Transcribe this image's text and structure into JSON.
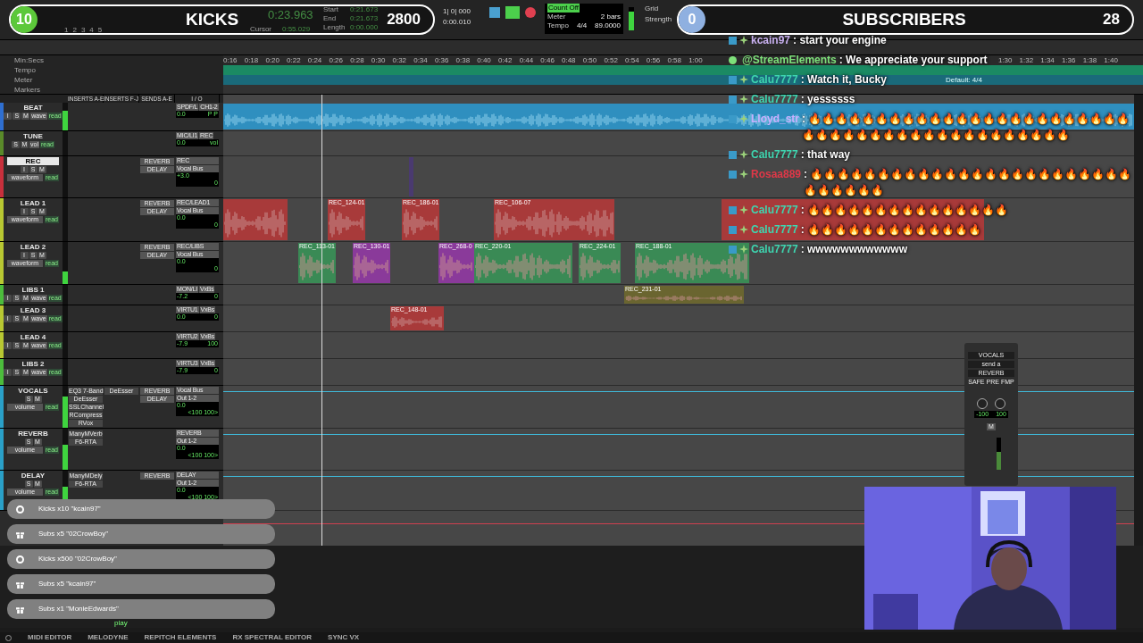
{
  "top_counters": [
    {
      "count": "10",
      "label": "KICKS",
      "total": "2800",
      "color": "#5cc83a"
    },
    {
      "count": "0",
      "label": "SUBSCRIBERS",
      "total": "28",
      "color": "#8fb0e0"
    }
  ],
  "toolbar": {
    "track_numbers": [
      "1",
      "2",
      "3",
      "4",
      "5"
    ],
    "main_counter": "0:23.963",
    "cursor_label": "Cursor",
    "cursor_value": "0:55.029",
    "selection": [
      {
        "label": "Start",
        "value": "0:21.673"
      },
      {
        "label": "End",
        "value": "0:21.673"
      },
      {
        "label": "Length",
        "value": "0:00.000"
      }
    ],
    "nudge": [
      "1| 0| 000",
      "0:00.010"
    ],
    "count_off": "Count Off",
    "meter_label": "Meter",
    "tempo_label": "Tempo",
    "bars": "2 bars",
    "meter": "4/4",
    "tempo": "89.0000",
    "grid_label": "Grid",
    "strength_label": "Strength",
    "level": 0.8
  },
  "rulers": {
    "labels": [
      "Min:Secs",
      "Tempo",
      "Meter",
      "Markers"
    ],
    "meter_default": "Default: 4/4",
    "ticks_left": [
      "0:16",
      "0:18",
      "0:20",
      "0:22",
      "0:24",
      "0:26",
      "0:28",
      "0:30",
      "0:32",
      "0:34",
      "0:36",
      "0:38",
      "0:40",
      "0:42",
      "0:44",
      "0:46",
      "0:48",
      "0:50",
      "0:52",
      "0:54",
      "0:56",
      "0:58",
      "1:00"
    ],
    "ticks_right": [
      "1:30",
      "1:32",
      "1:34",
      "1:36",
      "1:38",
      "1:40"
    ]
  },
  "columns": [
    "INSERTS A-E",
    "INSERTS F-J",
    "SENDS A-E",
    "I / O"
  ],
  "tracks": [
    {
      "name": "BEAT",
      "color": "#2f6fd0",
      "selected": false,
      "buttons": [
        "I",
        "S",
        "M"
      ],
      "view": "wave",
      "automation": "read",
      "io_in": "SPDF/L",
      "io_out": "CH1-2",
      "vol": "0.0",
      "pan": "P P",
      "level": 0.7,
      "clips": [
        {
          "color": "#2f8fbf"
        }
      ]
    },
    {
      "name": "TUNE",
      "color": "#5a8a2a",
      "selected": false,
      "buttons": [
        "S",
        "M"
      ],
      "view": "vol",
      "automation": "read",
      "io_in": "MIC/LI1",
      "io_out": "REC",
      "vol": "0.0",
      "pan": "vol"
    },
    {
      "name": "REC",
      "color": "#c8303c",
      "selected": true,
      "buttons": [
        "I",
        "S",
        "M"
      ],
      "view": "waveform",
      "automation": "read",
      "sends": [
        "REVERB",
        "DELAY"
      ],
      "io_in": "REC",
      "io_out": "Vocal Bus",
      "vol": "+3.0",
      "pan": "0",
      "clips": [
        {
          "color": "#4a3a70"
        }
      ]
    },
    {
      "name": "LEAD 1",
      "color": "#b8c832",
      "selected": false,
      "buttons": [
        "I",
        "S",
        "M"
      ],
      "view": "waveform",
      "automation": "read",
      "sends": [
        "REVERB",
        "DELAY"
      ],
      "io_in": "REC/LEAD1",
      "io_out": "Vocal Bus",
      "vol": "0.0",
      "pan": "0",
      "clips": [
        {
          "color": "#a83a3a"
        },
        {
          "label": "REC_124-01",
          "color": "#a83a3a"
        },
        {
          "label": "REC_186-01",
          "color": "#a83a3a"
        },
        {
          "label": "REC_106-07",
          "color": "#a83a3a"
        },
        {
          "color": "#a83a3a"
        }
      ]
    },
    {
      "name": "LEAD 2",
      "color": "#b8c832",
      "selected": false,
      "buttons": [
        "I",
        "S",
        "M"
      ],
      "view": "waveform",
      "automation": "read",
      "sends": [
        "REVERB",
        "DELAY"
      ],
      "io_in": "REC/LIBS",
      "io_out": "Vocal Bus",
      "vol": "0.0",
      "pan": "0",
      "level": 0.3,
      "clips": [
        {
          "label": "REC_113-01",
          "color": "#3a8a55"
        },
        {
          "label": "REC_130-01",
          "color": "#8a3a9a"
        },
        {
          "label": "REC_268-0",
          "color": "#8a3a9a"
        },
        {
          "label": "REC_220-01",
          "color": "#3a8a55"
        },
        {
          "label": "REC_224-01",
          "color": "#3a8a55"
        },
        {
          "label": "REC_188-01",
          "color": "#3a8a55"
        }
      ]
    },
    {
      "name": "LIBS 1",
      "color": "#4cbc3c",
      "selected": false,
      "buttons": [
        "I",
        "S",
        "M"
      ],
      "view": "wave",
      "automation": "read",
      "io_in": "MON/LI",
      "io_out": "VxBs",
      "vol": "-7.2",
      "pan": "0",
      "clips": [
        {
          "label": "REC_231-01",
          "color": "#6a6530"
        }
      ]
    },
    {
      "name": "LEAD 3",
      "color": "#b8c832",
      "selected": false,
      "buttons": [
        "I",
        "S",
        "M"
      ],
      "view": "wave",
      "automation": "read",
      "io_in": "VIRTU1",
      "io_out": "VxBs",
      "vol": "0.0",
      "pan": "0",
      "clips": [
        {
          "label": "REC_148-01",
          "color": "#a83a3a"
        }
      ]
    },
    {
      "name": "LEAD 4",
      "color": "#b8c832",
      "selected": false,
      "buttons": [
        "I",
        "S",
        "M"
      ],
      "view": "wave",
      "automation": "read",
      "io_in": "VIRTU2",
      "io_out": "VxBs",
      "vol": "-7.9",
      "pan": "100"
    },
    {
      "name": "LIBS 2",
      "color": "#4cbc3c",
      "selected": false,
      "buttons": [
        "I",
        "S",
        "M"
      ],
      "view": "wave",
      "automation": "read",
      "io_in": "VIRTU3",
      "io_out": "VxBs",
      "vol": "-7.9",
      "pan": "0"
    },
    {
      "name": "VOCALS",
      "color": "#2aa0c8",
      "selected": false,
      "buttons": [
        "S",
        "M"
      ],
      "view": "volume",
      "automation": "read",
      "inserts": [
        "EQ3 7-Band",
        "DeEsser",
        "SSLChannel",
        "RCompress",
        "RVox"
      ],
      "inserts_fj": [
        "DeEsser"
      ],
      "sends": [
        "REVERB",
        "DELAY"
      ],
      "io_in": "Vocal Bus",
      "io_out": "Out 1-2",
      "vol": "0.0",
      "pan": "<100 100>",
      "level": 0.75
    },
    {
      "name": "REVERB",
      "color": "#2aa0c8",
      "selected": false,
      "buttons": [
        "S",
        "M"
      ],
      "view": "volume",
      "automation": "read",
      "inserts": [
        "ManyMVerb",
        "F6-RTA"
      ],
      "io_in": "REVERB",
      "io_out": "Out 1-2",
      "vol": "0.0",
      "pan": "<100 100>",
      "level": 0.6
    },
    {
      "name": "DELAY",
      "color": "#2aa0c8",
      "selected": false,
      "buttons": [
        "S",
        "M"
      ],
      "view": "volume",
      "automation": "read",
      "inserts": [
        "ManyMDely",
        "F6-RTA"
      ],
      "sends": [
        "REVERB"
      ],
      "io_in": "DELAY",
      "io_out": "Out 1-2",
      "vol": "0.0",
      "pan": "<100 100>",
      "level": 0.6
    }
  ],
  "chat": [
    {
      "kind": "user",
      "user": "kcain97",
      "color": "#c8b0f0",
      "text": ": start your engine"
    },
    {
      "kind": "bot",
      "user": "@StreamElements",
      "color": "#7ee07a",
      "text": ": We appreciate your support"
    },
    {
      "kind": "user",
      "user": "Calu7777",
      "color": "#3ed6b0",
      "text": ": Watch it, Bucky"
    },
    {
      "kind": "user",
      "user": "Calu7777",
      "color": "#3ed6b0",
      "text": ": yessssss"
    },
    {
      "kind": "user",
      "user": "Lloyd_str",
      "color": "#c8b0ff",
      "text": ": 🔥🔥🔥🔥🔥🔥🔥🔥🔥🔥🔥🔥🔥🔥🔥🔥🔥🔥🔥🔥🔥🔥🔥🔥🔥🔥🔥🔥🔥🔥🔥🔥🔥🔥🔥🔥🔥🔥🔥🔥🔥🔥🔥🔥"
    },
    {
      "kind": "user",
      "user": "Calu7777",
      "color": "#3ed6b0",
      "text": ": that way"
    },
    {
      "kind": "user",
      "user": "Rosaa889",
      "color": "#e03848",
      "text": ": 🔥🔥🔥🔥🔥🔥🔥🔥🔥🔥🔥🔥🔥🔥🔥🔥🔥🔥🔥🔥🔥🔥🔥🔥🔥🔥🔥🔥🔥🔥"
    },
    {
      "kind": "user",
      "user": "Calu7777",
      "color": "#3ed6b0",
      "text": ": 🔥🔥🔥🔥🔥🔥🔥🔥🔥🔥🔥🔥🔥🔥🔥"
    },
    {
      "kind": "user",
      "user": "Calu7777",
      "color": "#3ed6b0",
      "text": ": 🔥🔥🔥🔥🔥🔥🔥🔥🔥🔥🔥🔥🔥"
    },
    {
      "kind": "user",
      "user": "Calu7777",
      "color": "#3ed6b0",
      "text": ": wwwwwwwwwwww"
    }
  ],
  "alerts": [
    {
      "kind": "kick",
      "text": "Kicks x10 \"kcain97\""
    },
    {
      "kind": "sub",
      "text": "Subs x5 \"02CrowBoy\""
    },
    {
      "kind": "kick",
      "text": "Kicks x500 \"02CrowBoy\""
    },
    {
      "kind": "sub",
      "text": "Subs x5 \"kcain97\""
    },
    {
      "kind": "sub",
      "text": "Subs x1 \"MonieEdwards\""
    }
  ],
  "send_window": {
    "track": "VOCALS",
    "send": "send a",
    "bus": "REVERB",
    "buttons": [
      "SAFE",
      "PRE",
      "FMP"
    ],
    "pan": [
      "-100",
      "100"
    ],
    "mute": "M",
    "level": 0.55
  },
  "transport_label": "play",
  "bottom_tabs": [
    "MIDI EDITOR",
    "MELODYNE",
    "REPITCH ELEMENTS",
    "RX SPECTRAL EDITOR",
    "SYNC VX"
  ]
}
